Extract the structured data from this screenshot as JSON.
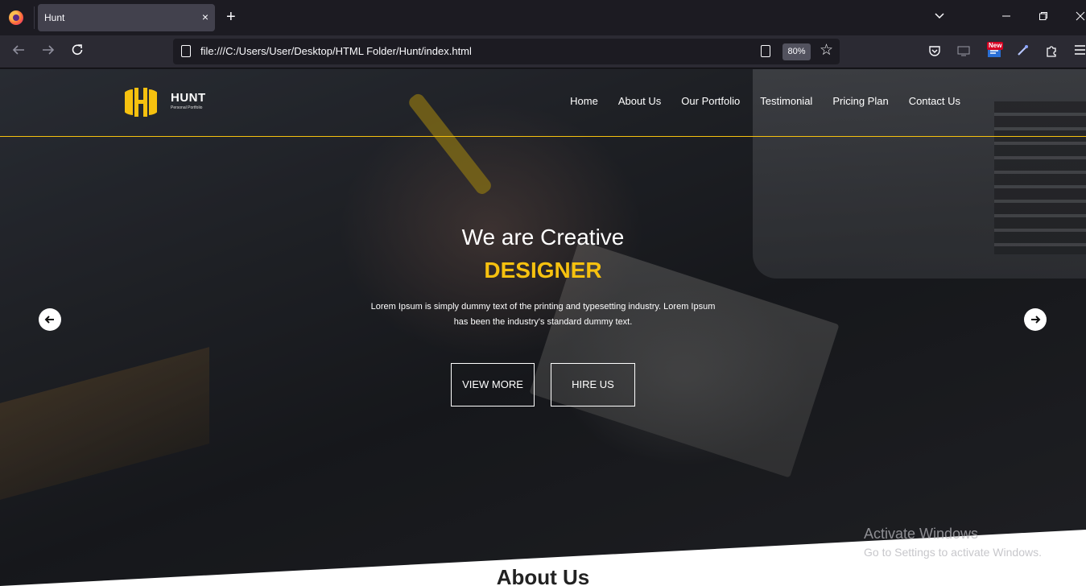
{
  "browser": {
    "tab_title": "Hunt",
    "tab_close": "×",
    "new_tab": "+",
    "url": "file:///C:/Users/User/Desktop/HTML Folder/Hunt/index.html",
    "zoom": "80%",
    "new_badge": "New"
  },
  "site": {
    "logo_text": "HUNT",
    "logo_sub": "Personal Portfolio",
    "nav": [
      "Home",
      "About Us",
      "Our Portfolio",
      "Testimonial",
      "Pricing Plan",
      "Contact Us"
    ],
    "accent_color": "#f6c10f"
  },
  "hero": {
    "subtitle": "We are Creative",
    "title": "DESIGNER",
    "description": "Lorem Ipsum is simply dummy text of the printing and typesetting industry. Lorem Ipsum has been the industry's standard dummy text.",
    "view_more": "VIEW MORE",
    "hire_us": "HIRE US",
    "prev_icon": "arrow-left-icon",
    "next_icon": "arrow-right-icon"
  },
  "about": {
    "heading": "About Us"
  },
  "os_watermark": {
    "title": "Activate Windows",
    "subtitle": "Go to Settings to activate Windows."
  }
}
